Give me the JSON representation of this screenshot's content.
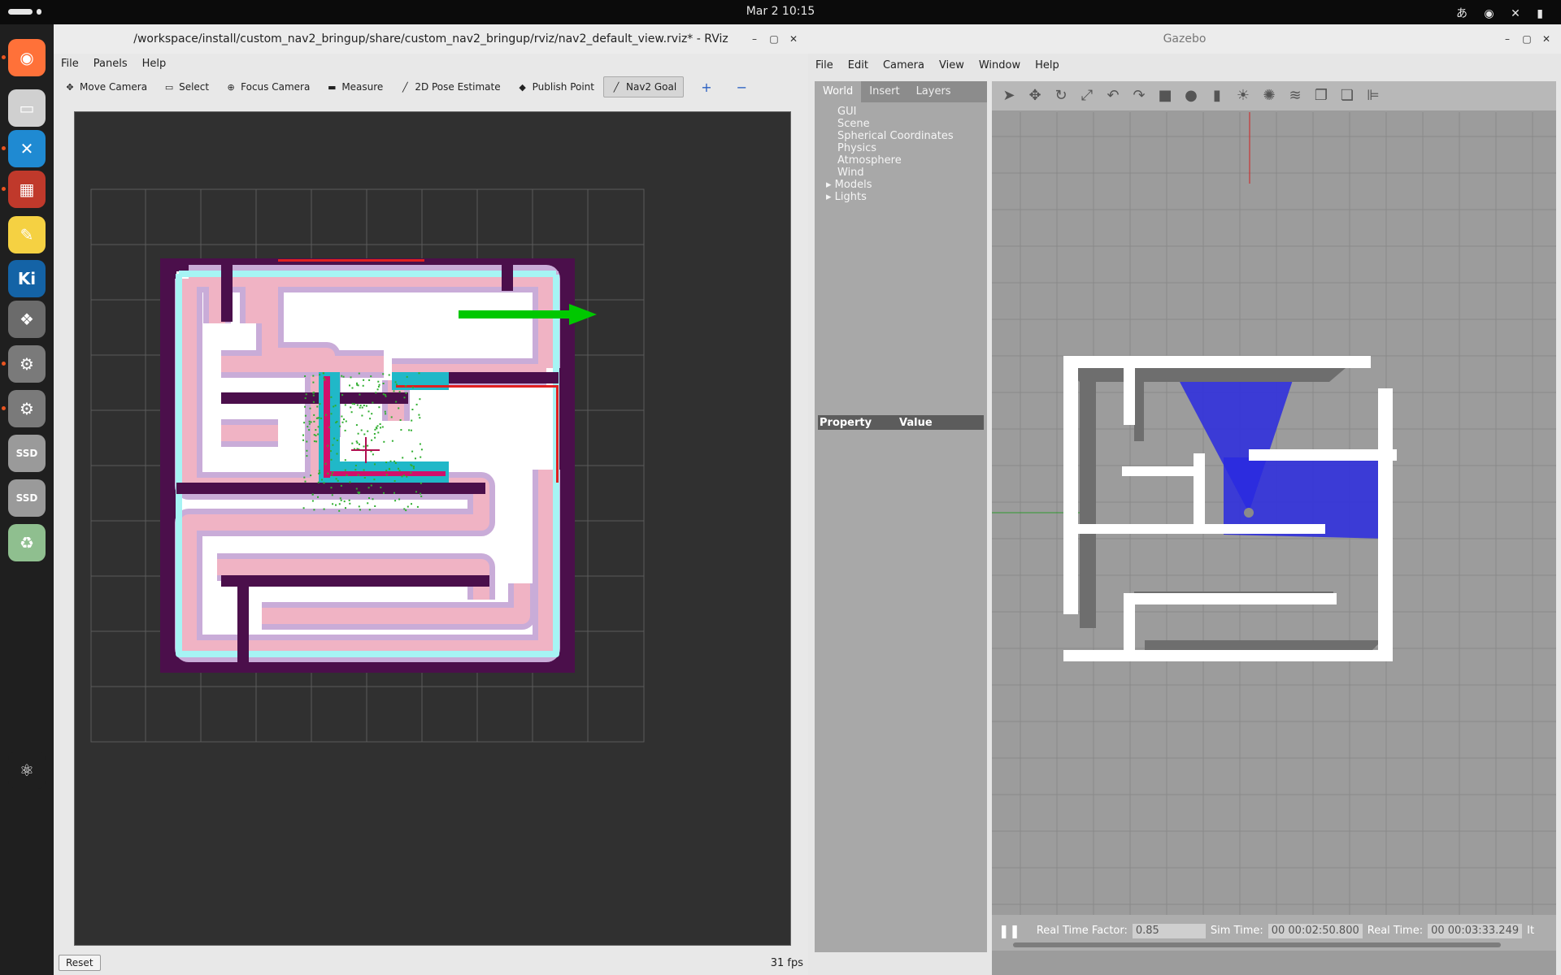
{
  "topbar": {
    "clock": "Mar 2  10:15",
    "tray": "あ ◉ ✕ ▮"
  },
  "dock": {
    "items": [
      {
        "name": "firefox-icon",
        "color": "#ff7139",
        "glyph": "◉"
      },
      {
        "name": "files-icon",
        "color": "#d0d0d0",
        "glyph": "▭"
      },
      {
        "name": "vscode-icon",
        "color": "#1f8ad2",
        "glyph": "✕"
      },
      {
        "name": "terminal-icon",
        "color": "#c0392b",
        "glyph": "▦"
      },
      {
        "name": "text-editor-icon",
        "color": "#f5d142",
        "glyph": "✎"
      },
      {
        "name": "kicad-icon",
        "color": "#1463a6",
        "glyph": "Ki"
      },
      {
        "name": "gimp-icon",
        "color": "#6b6b6b",
        "glyph": "❖"
      },
      {
        "name": "settings-icon",
        "color": "#7a7a7a",
        "glyph": "⚙"
      },
      {
        "name": "settings-2-icon",
        "color": "#7a7a7a",
        "glyph": "⚙"
      },
      {
        "name": "ssd-1-icon",
        "color": "#9a9a9a",
        "glyph": "SSD"
      },
      {
        "name": "ssd-2-icon",
        "color": "#9a9a9a",
        "glyph": "SSD"
      },
      {
        "name": "trash-icon",
        "color": "#8fbf8f",
        "glyph": "♻"
      },
      {
        "name": "ubuntu-icon",
        "color": "#1f1f1f",
        "glyph": "⚛"
      }
    ]
  },
  "rviz": {
    "title": "/workspace/install/custom_nav2_bringup/share/custom_nav2_bringup/rviz/nav2_default_view.rviz* - RViz",
    "menu": [
      "File",
      "Panels",
      "Help"
    ],
    "tools": [
      {
        "label": "Move Camera",
        "icon": "✥",
        "active": false
      },
      {
        "label": "Select",
        "icon": "▭",
        "active": false
      },
      {
        "label": "Focus Camera",
        "icon": "⊕",
        "active": false
      },
      {
        "label": "Measure",
        "icon": "▬",
        "active": false
      },
      {
        "label": "2D Pose Estimate",
        "icon": "╱",
        "active": false
      },
      {
        "label": "Publish Point",
        "icon": "◆",
        "active": false
      },
      {
        "label": "Nav2 Goal",
        "icon": "╱",
        "active": true
      }
    ],
    "plus": "+",
    "minus": "−",
    "reset": "Reset",
    "fps": "31 fps",
    "colors": {
      "costmap_dark": "#4b0f4b",
      "inflation_cyan": "#a6f4f4",
      "inflation_pink": "#f0b3c4",
      "inflation_lilac": "#c9acd8",
      "goal_arrow": "#00c800"
    }
  },
  "gazebo": {
    "title": "Gazebo",
    "menu": [
      "File",
      "Edit",
      "Camera",
      "View",
      "Window",
      "Help"
    ],
    "tabs": [
      "World",
      "Insert",
      "Layers"
    ],
    "tree": [
      "GUI",
      "Scene",
      "Spherical Coordinates",
      "Physics",
      "Atmosphere",
      "Wind",
      "Models",
      "Lights"
    ],
    "property_header": "Property",
    "value_header": "Value",
    "rtf_label": "Real Time Factor:",
    "rtf_value": "0.85",
    "sim_label": "Sim Time:",
    "sim_value": "00 00:02:50.800",
    "real_label": "Real Time:",
    "real_value": "00 00:03:33.249",
    "iter_label": "It"
  }
}
